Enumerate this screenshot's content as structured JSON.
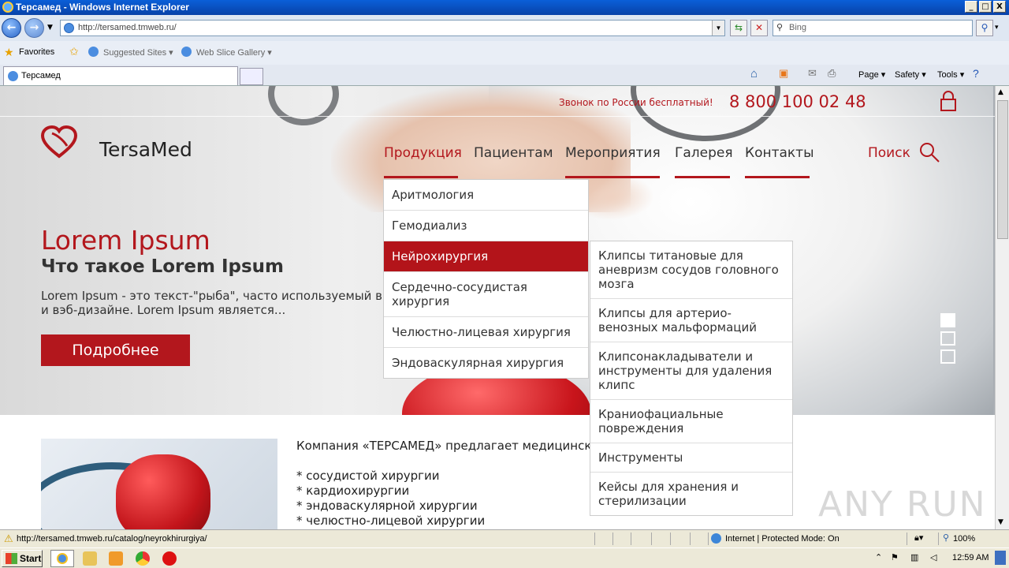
{
  "window": {
    "title": "Терсамед - Windows Internet Explorer",
    "min": "_",
    "max": "□",
    "close": "X"
  },
  "browser": {
    "url": "http://tersamed.tmweb.ru/",
    "search_placeholder": "Bing",
    "favorites_label": "Favorites",
    "suggested_sites": "Suggested Sites ▾",
    "web_slice_gallery": "Web Slice Gallery ▾",
    "tab_title": "Терсамед",
    "commands": {
      "page": "Page ▾",
      "safety": "Safety ▾",
      "tools": "Tools ▾"
    }
  },
  "site": {
    "phone_note": "Звонок по России бесплатный!",
    "phone": "8 800 100 02 48",
    "logo_text": "TersaMed",
    "nav": [
      "Продукция",
      "Пациентам",
      "Мероприятия",
      "Галерея",
      "Контакты"
    ],
    "search_label": "Поиск",
    "hero": {
      "title": "Lorem Ipsum",
      "subtitle": "Что такое Lorem Ipsum",
      "text": "Lorem Ipsum - это текст-\"рыба\", часто используемый в п и вэб-дизайне. Lorem Ipsum является...",
      "button": "Подробнее"
    },
    "menu_products": [
      "Аритмология",
      "Гемодиализ",
      "Нейрохирургия",
      "Сердечно-сосудистая хирургия",
      "Челюстно-лицевая хирургия",
      "Эндоваскулярная хирургия"
    ],
    "menu_neuro": [
      "Клипсы титановые для аневризм сосудов головного мозга",
      "Клипсы для артерио-венозных мальформаций",
      "Клипсонакладыватели и инструменты для удаления клипс",
      "Краниофациальные повреждения",
      "Инструменты",
      "Кейсы для хранения и стерилизации"
    ],
    "company": {
      "intro": "Компания «ТЕРСАМЕД» предлагает медицински",
      "items": [
        "* сосудистой хирургии",
        "* кардиохирургии",
        "* эндоваскулярной хирургии",
        "* челюстно-лицевой хирургии"
      ]
    },
    "watermark": "ANY RUN"
  },
  "status": {
    "url": "http://tersamed.tmweb.ru/catalog/neyrokhirurgiya/",
    "zone": "Internet | Protected Mode: On",
    "zoom": "100%"
  },
  "taskbar": {
    "start": "Start",
    "clock": "12:59 AM"
  },
  "colors": {
    "brand_red": "#b3171d",
    "menu_active": "#b3141a"
  }
}
